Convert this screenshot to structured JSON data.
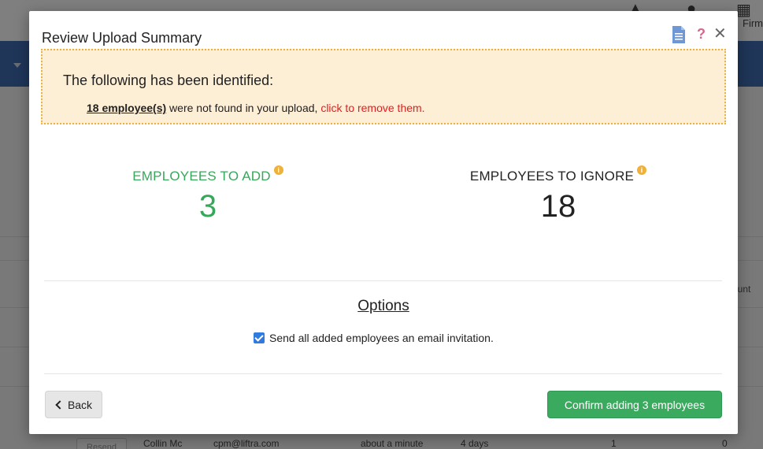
{
  "background": {
    "firm_label": "Firm",
    "count_label": "ount",
    "resend_label": "Resend",
    "row": {
      "name": "Collin Mc",
      "email": "cpm@liftra.com",
      "last_seen": "about a minute",
      "duration": "4 days",
      "count_a": "1",
      "count_b": "0"
    }
  },
  "modal": {
    "title": "Review Upload Summary",
    "alert": {
      "heading": "The following has been identified:",
      "count_link": "18 employee(s)",
      "message": " were not found in your upload, ",
      "action_link": "click to remove them."
    },
    "stats": {
      "add": {
        "label": "EMPLOYEES TO ADD",
        "value": "3"
      },
      "ignore": {
        "label": "EMPLOYEES TO IGNORE",
        "value": "18"
      }
    },
    "options": {
      "title": "Options",
      "email_invite_label": "Send all added employees an email invitation.",
      "email_invite_checked": true
    },
    "buttons": {
      "back": "Back",
      "confirm": "Confirm adding 3 employees"
    }
  },
  "colors": {
    "accent_green": "#36a85a",
    "alert_bg": "#fdeed6",
    "alert_border": "#f0b23c",
    "danger_red": "#e02020",
    "checkbox_blue": "#2f7be0",
    "nav_blue": "#3f6db3"
  }
}
